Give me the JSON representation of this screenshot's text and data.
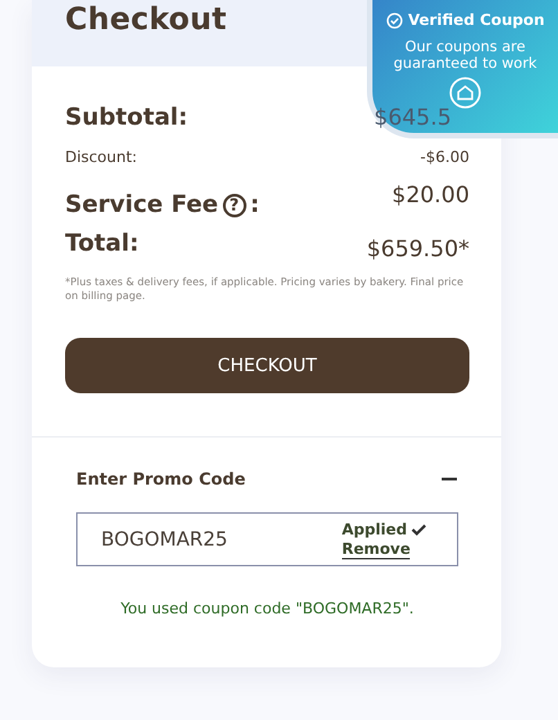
{
  "header": {
    "title": "Checkout"
  },
  "summary": [
    {
      "kind": "large",
      "label": "Subtotal:",
      "value": "$645.5"
    },
    {
      "kind": "small",
      "label": "Discount:",
      "value": "-$6.00"
    },
    {
      "kind": "help",
      "label": "Service Fee",
      "suffix": ":",
      "help": "?",
      "value": "$20.00"
    },
    {
      "kind": "large",
      "label": "Total:",
      "value": "$659.50*"
    }
  ],
  "note": "*Plus taxes & delivery fees, if applicable. Pricing varies by bakery. Final price on billing page.",
  "checkout_button": "CHECKOUT",
  "promo": {
    "title": "Enter Promo Code",
    "expanded": true,
    "value": "BOGOMAR25",
    "status": "Applied",
    "remove": "Remove",
    "message": "You used coupon code \"BOGOMAR25\"."
  },
  "badge": {
    "title": "Verified Coupon",
    "text": "Our coupons are guaranteed to work"
  }
}
